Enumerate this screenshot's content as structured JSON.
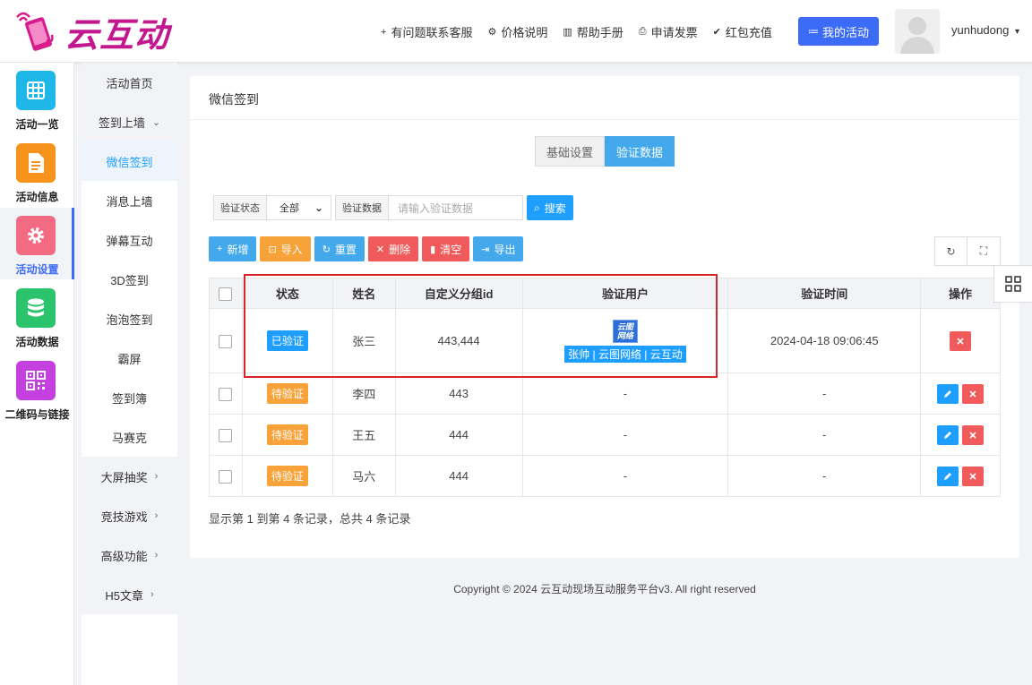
{
  "brand": {
    "name": "云互动"
  },
  "topnav": [
    {
      "icon": "user-add-icon",
      "glyph": "+",
      "label": "有问题联系客服"
    },
    {
      "icon": "gear-icon",
      "glyph": "⚙",
      "label": "价格说明"
    },
    {
      "icon": "book-icon",
      "glyph": "▥",
      "label": "帮助手册"
    },
    {
      "icon": "printer-icon",
      "glyph": "⎙",
      "label": "申请发票"
    },
    {
      "icon": "shield-icon",
      "glyph": "✔",
      "label": "红包充值"
    }
  ],
  "my_activity": {
    "label": "我的活动",
    "glyph": "≔"
  },
  "user": {
    "name": "yunhudong",
    "caret": "▾"
  },
  "iconbar": [
    {
      "label": "活动一览",
      "icon": "grid-icon",
      "color": "#1fb6e8"
    },
    {
      "label": "活动信息",
      "icon": "document-icon",
      "color": "#f7931d"
    },
    {
      "label": "活动设置",
      "icon": "gear-icon",
      "color": "#f26b82"
    },
    {
      "label": "活动数据",
      "icon": "database-icon",
      "color": "#2bc36b"
    },
    {
      "label": "二维码与链接",
      "icon": "qrcode-icon",
      "color": "#c441e0"
    }
  ],
  "submenu": [
    {
      "label": "活动首页",
      "arrow": ""
    },
    {
      "label": "签到上墙",
      "arrow": "⌄"
    },
    {
      "label": "微信签到",
      "arrow": ""
    },
    {
      "label": "消息上墙",
      "arrow": ""
    },
    {
      "label": "弹幕互动",
      "arrow": ""
    },
    {
      "label": "3D签到",
      "arrow": ""
    },
    {
      "label": "泡泡签到",
      "arrow": ""
    },
    {
      "label": "霸屏",
      "arrow": ""
    },
    {
      "label": "签到簿",
      "arrow": ""
    },
    {
      "label": "马赛克",
      "arrow": ""
    },
    {
      "label": "大屏抽奖",
      "arrow": "›"
    },
    {
      "label": "竞技游戏",
      "arrow": "›"
    },
    {
      "label": "高级功能",
      "arrow": "›"
    },
    {
      "label": "H5文章",
      "arrow": "›"
    }
  ],
  "panel": {
    "title": "微信签到"
  },
  "tabs": [
    "基础设置",
    "验证数据"
  ],
  "filter": {
    "status_label": "验证状态",
    "status_value": "全部",
    "status_caret": "⌄",
    "data_label": "验证数据",
    "data_placeholder": "请输入验证数据",
    "search_label": "搜索",
    "search_glyph": "⌕"
  },
  "toolbar": [
    {
      "label": "新增",
      "glyph": "+",
      "style": "blue",
      "icon": "plus-icon"
    },
    {
      "label": "导入",
      "glyph": "⊡",
      "style": "orange",
      "icon": "import-icon"
    },
    {
      "label": "重置",
      "glyph": "↻",
      "style": "blue",
      "icon": "reset-icon"
    },
    {
      "label": "删除",
      "glyph": "✕",
      "style": "red",
      "icon": "delete-icon"
    },
    {
      "label": "清空",
      "glyph": "▮",
      "style": "red",
      "icon": "trash-icon"
    },
    {
      "label": "导出",
      "glyph": "⇥",
      "style": "blue",
      "icon": "export-icon"
    }
  ],
  "tools": [
    {
      "glyph": "↻",
      "icon": "refresh-icon"
    },
    {
      "glyph": "⛶",
      "icon": "fullscreen-icon"
    }
  ],
  "table": {
    "headers": [
      "状态",
      "姓名",
      "自定义分组id",
      "验证用户",
      "验证时间",
      "操作"
    ],
    "rows": [
      {
        "status": "已验证",
        "status_type": "ok",
        "name": "张三",
        "group": "443,444",
        "user_logo": "云图网络",
        "user_tag": "张帅 | 云图网络 | 云互动",
        "time": "2024-04-18 09:06:45",
        "edit": false
      },
      {
        "status": "待验证",
        "status_type": "wait",
        "name": "李四",
        "group": "443",
        "user": "-",
        "time": "-",
        "edit": true
      },
      {
        "status": "待验证",
        "status_type": "wait",
        "name": "王五",
        "group": "444",
        "user": "-",
        "time": "-",
        "edit": true
      },
      {
        "status": "待验证",
        "status_type": "wait",
        "name": "马六",
        "group": "444",
        "user": "-",
        "time": "-",
        "edit": true
      }
    ]
  },
  "summary": "显示第 1 到第 4 条记录，总共 4 条记录",
  "copyright": "Copyright © 2024 云互动现场互动服务平台v3. All right reserved"
}
